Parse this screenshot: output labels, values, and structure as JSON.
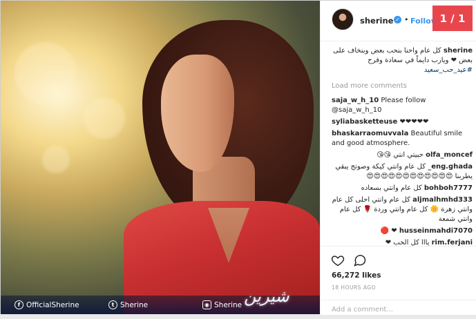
{
  "post": {
    "username": "sherine",
    "follow_label": "Follow",
    "dot": "•",
    "counter": "1 / 1"
  },
  "photo": {
    "facebook_handle": "OfficialSherine",
    "twitter_handle": "Sherine",
    "instagram_handle": "Sherine",
    "signature_text": "شيرين"
  },
  "caption": {
    "username": "sherine",
    "text": "كل عام واحنا بنحب بعض وبنخاف على بعض ❤ ويارب دايماً في سعادة وفرح",
    "hashtag": "#عيد_حب_سعيد"
  },
  "load_more": "Load more comments",
  "comments": [
    {
      "user": "saja_w_h_10",
      "text": "Please follow @saja_w_h_10",
      "rtl": false
    },
    {
      "user": "syliabasketteuse",
      "text": "❤❤❤❤❤",
      "rtl": false
    },
    {
      "user": "bhaskarraomuvvala",
      "text": "Beautiful smile and good atmosphere.",
      "rtl": false
    },
    {
      "user": "olfa_moncef",
      "text": "حبيتي انتي 😘😘",
      "rtl": true
    },
    {
      "user": "eng.ghada_",
      "text": "كل عام وانتي كيكة وصوتج يبقي يطربنا 😍😍😍😍😍😍😍😍😍😍😍😍",
      "rtl": true
    },
    {
      "user": "bohboh7777",
      "text": "كل عام وانتي بسعاده",
      "rtl": true
    },
    {
      "user": "aljmalhmhd333",
      "text": "كل عام وانتي احلى كل عام وانتي زهرة 🌼 كل عام وانتي وردة 🌹 كل عام وانتي شمعة",
      "rtl": true
    },
    {
      "user": "husseinmahdi7070",
      "text": "❤ 🔴",
      "rtl": true
    },
    {
      "user": "rim.ferjani",
      "text": "يااا كل الحب ❤",
      "rtl": true
    }
  ],
  "likes": "66,272 likes",
  "time_ago": "18 HOURS AGO",
  "add_comment_placeholder": "Add a comment...",
  "colors": {
    "accent_blue": "#3897f0",
    "counter_bg": "#e8464d",
    "text_dark": "#262626",
    "muted": "#999999"
  }
}
